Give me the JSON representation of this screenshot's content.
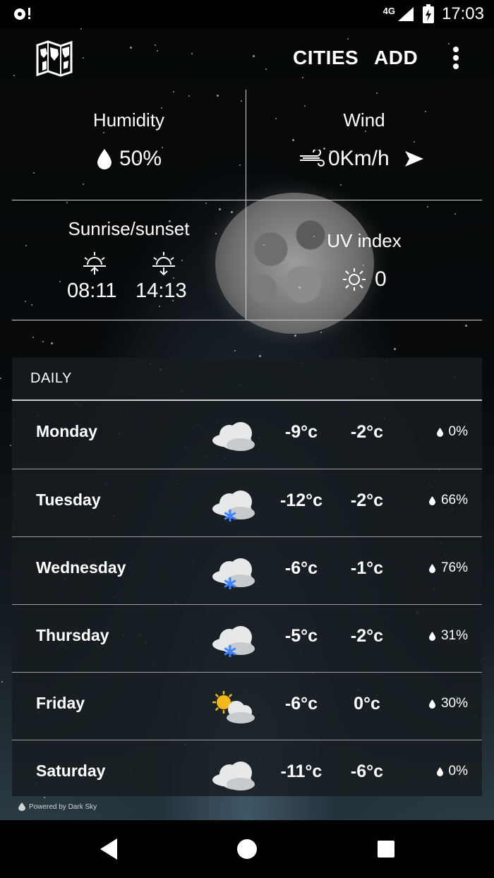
{
  "status_bar": {
    "left_icons": "notification-icons",
    "network": "4G",
    "time": "17:03"
  },
  "toolbar": {
    "cities_label": "CITIES",
    "add_label": "ADD",
    "logo": "world-map-icon",
    "overflow": "more-vert-icon"
  },
  "conditions": {
    "humidity": {
      "title": "Humidity",
      "value": "50%"
    },
    "wind": {
      "title": "Wind",
      "value": "0Km/h"
    },
    "sun": {
      "title": "Sunrise/sunset",
      "sunrise": "08:11",
      "sunset": "14:13"
    },
    "uv": {
      "title": "UV index",
      "value": "0"
    }
  },
  "daily": {
    "header": "DAILY",
    "rows": [
      {
        "day": "Monday",
        "icon": "cloudy-icon",
        "min": "-9°c",
        "max": "-2°c",
        "rain": "0%"
      },
      {
        "day": "Tuesday",
        "icon": "snow-icon",
        "min": "-12°c",
        "max": "-2°c",
        "rain": "66%"
      },
      {
        "day": "Wednesday",
        "icon": "snow-icon",
        "min": "-6°c",
        "max": "-1°c",
        "rain": "76%"
      },
      {
        "day": "Thursday",
        "icon": "snow-icon",
        "min": "-5°c",
        "max": "-2°c",
        "rain": "31%"
      },
      {
        "day": "Friday",
        "icon": "partly-cloudy-icon",
        "min": "-6°c",
        "max": "0°c",
        "rain": "30%"
      },
      {
        "day": "Saturday",
        "icon": "cloudy-icon",
        "min": "-11°c",
        "max": "-6°c",
        "rain": "0%"
      }
    ]
  },
  "footer": {
    "powered_by": "Powered by Dark Sky"
  },
  "colors": {
    "snowflake": "#3f82ff",
    "sun": "#f2b91c",
    "cloud": "#d8dcde"
  }
}
